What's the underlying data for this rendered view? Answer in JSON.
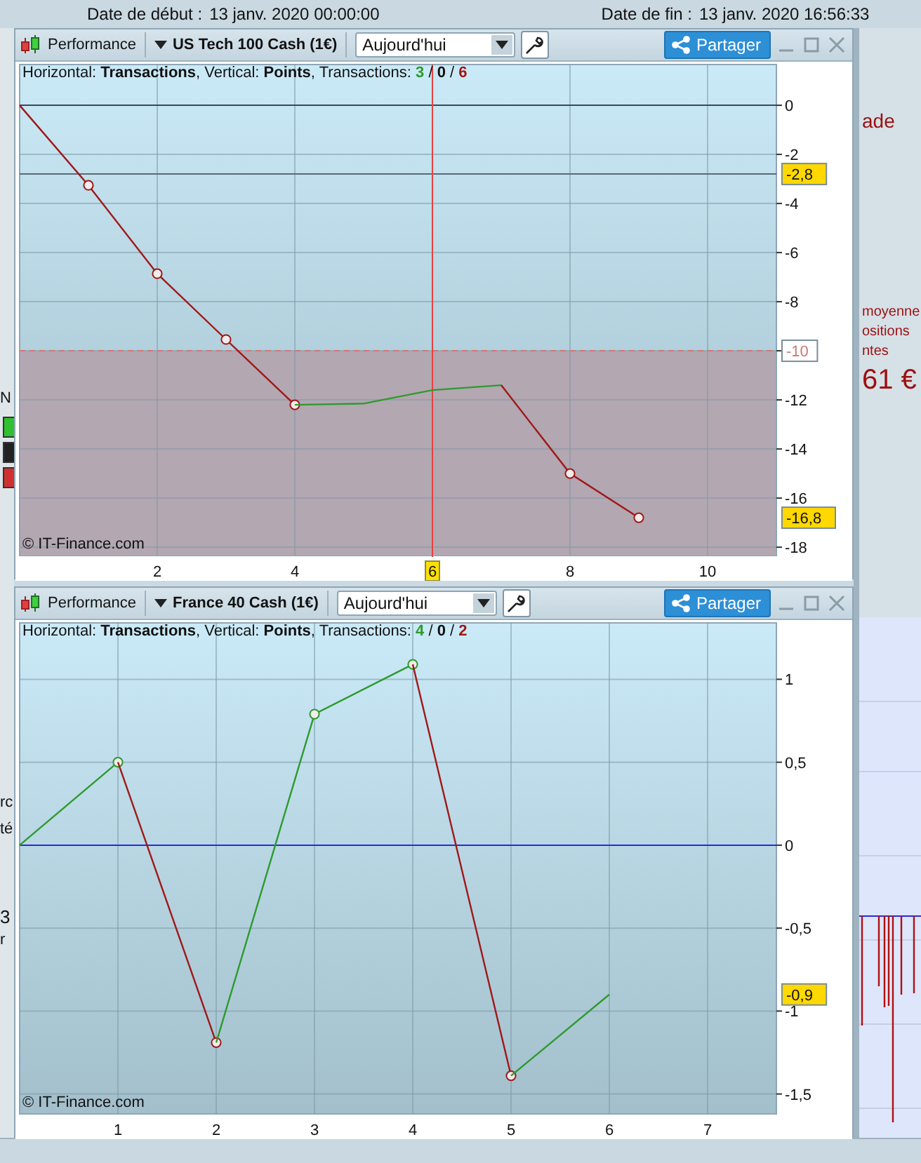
{
  "header": {
    "start_label": "Date de début :",
    "start_value": "13 janv. 2020 00:00:00",
    "end_label": "Date de fin :",
    "end_value": "13 janv. 2020 16:56:33"
  },
  "background": {
    "left_texts": [
      "N",
      "rc",
      "té",
      "3",
      "r"
    ],
    "right_texts": [
      {
        "text": "ade",
        "kind": "title"
      },
      {
        "text": "moyenne",
        "kind": "note"
      },
      {
        "text": "ositions",
        "kind": "note"
      },
      {
        "text": "ntes",
        "kind": "note"
      },
      {
        "text": "61 €",
        "kind": "amount"
      }
    ]
  },
  "windows": [
    {
      "title": "Performance",
      "instrument": "US Tech 100 Cash (1€)",
      "period": "Aujourd'hui",
      "share": "Partager",
      "legend": "Horizontal: **Transactions**, Vertical: **Points**, Transactions: ",
      "count_separator": " / ",
      "counts": [
        {
          "text": "3",
          "kind": "won"
        },
        {
          "text": "0",
          "kind": "neutral"
        },
        {
          "text": "6",
          "kind": "lost"
        }
      ],
      "copyright": "© IT-Finance.com",
      "chart_data": {
        "type": "line",
        "grid": true,
        "xlim": [
          0,
          11
        ],
        "ylim": [
          -18.34,
          1.66
        ],
        "xticks": [
          2,
          4,
          6,
          8,
          10
        ],
        "yticks": [
          0,
          -2,
          -4,
          -6,
          -8,
          -10,
          -12,
          -14,
          -16,
          -18
        ],
        "x": [
          0,
          1,
          2,
          3,
          4,
          5,
          6,
          7,
          8,
          9
        ],
        "series": [
          {
            "color": "#a01818",
            "marker": "circle",
            "values": [
              0,
              -3.26,
              -6.86,
              -9.54,
              -12.2,
              null,
              null,
              null,
              null,
              null
            ]
          },
          {
            "color": "#2e9a2e",
            "marker": "none",
            "values": [
              null,
              null,
              null,
              null,
              -12.2,
              -12.15,
              -11.6,
              -11.4,
              null,
              null
            ]
          },
          {
            "color": "#a01818",
            "marker": "circle",
            "values": [
              null,
              null,
              null,
              null,
              null,
              null,
              null,
              -11.4,
              -15,
              -16.8
            ]
          }
        ],
        "ref_lines": [
          {
            "axis": "y",
            "value": 0,
            "color": "#3a4a55"
          },
          {
            "axis": "y",
            "value": -2.8,
            "label": "-2,8",
            "color": "#5a6a74"
          },
          {
            "axis": "y",
            "value": -10,
            "label": "-10",
            "color": "#d07878"
          },
          {
            "axis": "x",
            "value": 6,
            "label": "6",
            "color": "#e84040"
          }
        ],
        "bands": [
          {
            "axis": "y",
            "from": -18.34,
            "to": -10,
            "color": "#b3a7b1"
          }
        ],
        "annotations": [
          "-16,8"
        ]
      }
    },
    {
      "title": "Performance",
      "instrument": "France 40 Cash (1€)",
      "period": "Aujourd'hui",
      "share": "Partager",
      "legend": "Horizontal: **Transactions**, Vertical: **Points**, Transactions: ",
      "count_separator": " / ",
      "counts": [
        {
          "text": "4",
          "kind": "won"
        },
        {
          "text": "0",
          "kind": "neutral"
        },
        {
          "text": "2",
          "kind": "lost"
        }
      ],
      "copyright": "© IT-Finance.com",
      "chart_data": {
        "type": "line",
        "grid": true,
        "xlim": [
          0,
          7.7
        ],
        "ylim": [
          -1.62,
          1.34
        ],
        "xticks": [
          1,
          2,
          3,
          4,
          5,
          6,
          7
        ],
        "yticks": [
          {
            "value": 1,
            "label": "1"
          },
          {
            "value": 0.5,
            "label": "0,5"
          },
          {
            "value": 0,
            "label": "0"
          },
          {
            "value": -0.5,
            "label": "-0,5"
          },
          {
            "value": -1,
            "label": "-1"
          },
          {
            "value": -1.5,
            "label": "-1,5"
          }
        ],
        "x": [
          0,
          1,
          2,
          3,
          4,
          5,
          6
        ],
        "series": [
          {
            "color": "#2e9a2e",
            "marker": "circle",
            "values": [
              0,
              0.5,
              null,
              null,
              null,
              null,
              null
            ]
          },
          {
            "color": "#a01818",
            "marker": "circle",
            "values": [
              null,
              0.5,
              -1.19,
              null,
              null,
              null,
              null
            ]
          },
          {
            "color": "#2e9a2e",
            "marker": "circle",
            "values": [
              null,
              null,
              -1.19,
              0.79,
              1.09,
              null,
              null
            ]
          },
          {
            "color": "#a01818",
            "marker": "circle",
            "values": [
              null,
              null,
              null,
              null,
              1.09,
              -1.39,
              null
            ]
          },
          {
            "color": "#2e9a2e",
            "marker": "none",
            "values": [
              null,
              null,
              null,
              null,
              null,
              -1.39,
              -0.9
            ]
          }
        ],
        "ref_lines": [
          {
            "axis": "y",
            "value": 0,
            "color": "#2a2ad8"
          }
        ],
        "annotations": [
          "-0,9"
        ]
      }
    }
  ]
}
